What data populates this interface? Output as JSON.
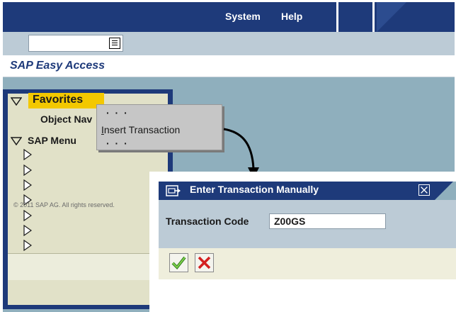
{
  "menubar": {
    "system": "System",
    "help": "Help"
  },
  "toolbar": {
    "command_value": "",
    "command_icon": "list-icon"
  },
  "page": {
    "title": "SAP Easy Access"
  },
  "tree": {
    "favorites_label": "Favorites",
    "favorites_items": [
      "Object Nav"
    ],
    "sap_menu_label": "SAP Menu",
    "sap_menu_item_count": 7
  },
  "copyright": "© 2011 SAP AG. All rights reserved.",
  "context_menu": {
    "items": [
      "· · ·",
      "Insert Transaction",
      "· · ·"
    ],
    "insert_mnemonic": "I",
    "insert_rest": "nsert Transaction"
  },
  "dialog": {
    "title": "Enter Transaction Manually",
    "field_label": "Transaction Code",
    "field_value": "Z00GS",
    "ok_icon": "checkmark-icon",
    "cancel_icon": "cancel-x-icon"
  },
  "colors": {
    "header_blue": "#1e3a7a",
    "toolbar": "#bccbd6",
    "workarea": "#8fafbd",
    "favorites_highlight": "#f3c800",
    "tree_bg": "#e1e1c8"
  }
}
